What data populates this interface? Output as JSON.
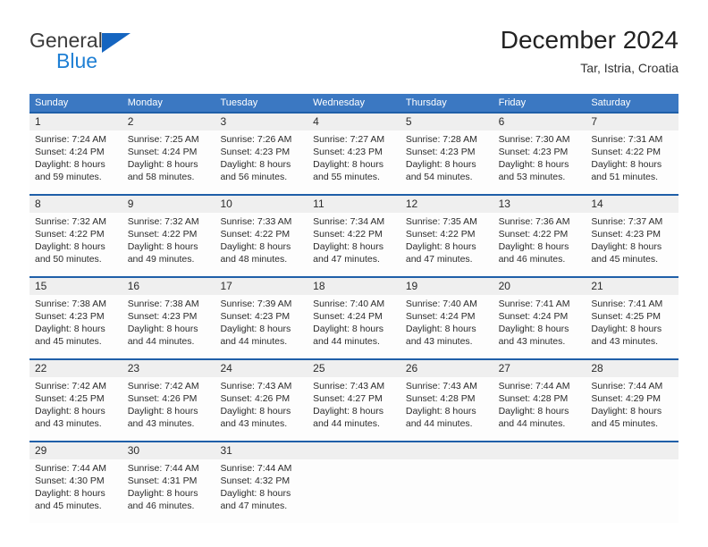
{
  "brand": {
    "name_part1": "General",
    "name_part2": "Blue",
    "icon": "flag-triangle-icon"
  },
  "header": {
    "title": "December 2024",
    "subtitle": "Tar, Istria, Croatia"
  },
  "colors": {
    "header_blue": "#3b78c2",
    "row_divider_blue": "#1f5fa8",
    "daynum_band": "#efefef",
    "brand_blue": "#1e7fd4"
  },
  "weekdays": [
    "Sunday",
    "Monday",
    "Tuesday",
    "Wednesday",
    "Thursday",
    "Friday",
    "Saturday"
  ],
  "weeks": [
    {
      "days": [
        {
          "num": "1",
          "sunrise": "Sunrise: 7:24 AM",
          "sunset": "Sunset: 4:24 PM",
          "daylight1": "Daylight: 8 hours",
          "daylight2": "and 59 minutes."
        },
        {
          "num": "2",
          "sunrise": "Sunrise: 7:25 AM",
          "sunset": "Sunset: 4:24 PM",
          "daylight1": "Daylight: 8 hours",
          "daylight2": "and 58 minutes."
        },
        {
          "num": "3",
          "sunrise": "Sunrise: 7:26 AM",
          "sunset": "Sunset: 4:23 PM",
          "daylight1": "Daylight: 8 hours",
          "daylight2": "and 56 minutes."
        },
        {
          "num": "4",
          "sunrise": "Sunrise: 7:27 AM",
          "sunset": "Sunset: 4:23 PM",
          "daylight1": "Daylight: 8 hours",
          "daylight2": "and 55 minutes."
        },
        {
          "num": "5",
          "sunrise": "Sunrise: 7:28 AM",
          "sunset": "Sunset: 4:23 PM",
          "daylight1": "Daylight: 8 hours",
          "daylight2": "and 54 minutes."
        },
        {
          "num": "6",
          "sunrise": "Sunrise: 7:30 AM",
          "sunset": "Sunset: 4:23 PM",
          "daylight1": "Daylight: 8 hours",
          "daylight2": "and 53 minutes."
        },
        {
          "num": "7",
          "sunrise": "Sunrise: 7:31 AM",
          "sunset": "Sunset: 4:22 PM",
          "daylight1": "Daylight: 8 hours",
          "daylight2": "and 51 minutes."
        }
      ]
    },
    {
      "days": [
        {
          "num": "8",
          "sunrise": "Sunrise: 7:32 AM",
          "sunset": "Sunset: 4:22 PM",
          "daylight1": "Daylight: 8 hours",
          "daylight2": "and 50 minutes."
        },
        {
          "num": "9",
          "sunrise": "Sunrise: 7:32 AM",
          "sunset": "Sunset: 4:22 PM",
          "daylight1": "Daylight: 8 hours",
          "daylight2": "and 49 minutes."
        },
        {
          "num": "10",
          "sunrise": "Sunrise: 7:33 AM",
          "sunset": "Sunset: 4:22 PM",
          "daylight1": "Daylight: 8 hours",
          "daylight2": "and 48 minutes."
        },
        {
          "num": "11",
          "sunrise": "Sunrise: 7:34 AM",
          "sunset": "Sunset: 4:22 PM",
          "daylight1": "Daylight: 8 hours",
          "daylight2": "and 47 minutes."
        },
        {
          "num": "12",
          "sunrise": "Sunrise: 7:35 AM",
          "sunset": "Sunset: 4:22 PM",
          "daylight1": "Daylight: 8 hours",
          "daylight2": "and 47 minutes."
        },
        {
          "num": "13",
          "sunrise": "Sunrise: 7:36 AM",
          "sunset": "Sunset: 4:22 PM",
          "daylight1": "Daylight: 8 hours",
          "daylight2": "and 46 minutes."
        },
        {
          "num": "14",
          "sunrise": "Sunrise: 7:37 AM",
          "sunset": "Sunset: 4:23 PM",
          "daylight1": "Daylight: 8 hours",
          "daylight2": "and 45 minutes."
        }
      ]
    },
    {
      "days": [
        {
          "num": "15",
          "sunrise": "Sunrise: 7:38 AM",
          "sunset": "Sunset: 4:23 PM",
          "daylight1": "Daylight: 8 hours",
          "daylight2": "and 45 minutes."
        },
        {
          "num": "16",
          "sunrise": "Sunrise: 7:38 AM",
          "sunset": "Sunset: 4:23 PM",
          "daylight1": "Daylight: 8 hours",
          "daylight2": "and 44 minutes."
        },
        {
          "num": "17",
          "sunrise": "Sunrise: 7:39 AM",
          "sunset": "Sunset: 4:23 PM",
          "daylight1": "Daylight: 8 hours",
          "daylight2": "and 44 minutes."
        },
        {
          "num": "18",
          "sunrise": "Sunrise: 7:40 AM",
          "sunset": "Sunset: 4:24 PM",
          "daylight1": "Daylight: 8 hours",
          "daylight2": "and 44 minutes."
        },
        {
          "num": "19",
          "sunrise": "Sunrise: 7:40 AM",
          "sunset": "Sunset: 4:24 PM",
          "daylight1": "Daylight: 8 hours",
          "daylight2": "and 43 minutes."
        },
        {
          "num": "20",
          "sunrise": "Sunrise: 7:41 AM",
          "sunset": "Sunset: 4:24 PM",
          "daylight1": "Daylight: 8 hours",
          "daylight2": "and 43 minutes."
        },
        {
          "num": "21",
          "sunrise": "Sunrise: 7:41 AM",
          "sunset": "Sunset: 4:25 PM",
          "daylight1": "Daylight: 8 hours",
          "daylight2": "and 43 minutes."
        }
      ]
    },
    {
      "days": [
        {
          "num": "22",
          "sunrise": "Sunrise: 7:42 AM",
          "sunset": "Sunset: 4:25 PM",
          "daylight1": "Daylight: 8 hours",
          "daylight2": "and 43 minutes."
        },
        {
          "num": "23",
          "sunrise": "Sunrise: 7:42 AM",
          "sunset": "Sunset: 4:26 PM",
          "daylight1": "Daylight: 8 hours",
          "daylight2": "and 43 minutes."
        },
        {
          "num": "24",
          "sunrise": "Sunrise: 7:43 AM",
          "sunset": "Sunset: 4:26 PM",
          "daylight1": "Daylight: 8 hours",
          "daylight2": "and 43 minutes."
        },
        {
          "num": "25",
          "sunrise": "Sunrise: 7:43 AM",
          "sunset": "Sunset: 4:27 PM",
          "daylight1": "Daylight: 8 hours",
          "daylight2": "and 44 minutes."
        },
        {
          "num": "26",
          "sunrise": "Sunrise: 7:43 AM",
          "sunset": "Sunset: 4:28 PM",
          "daylight1": "Daylight: 8 hours",
          "daylight2": "and 44 minutes."
        },
        {
          "num": "27",
          "sunrise": "Sunrise: 7:44 AM",
          "sunset": "Sunset: 4:28 PM",
          "daylight1": "Daylight: 8 hours",
          "daylight2": "and 44 minutes."
        },
        {
          "num": "28",
          "sunrise": "Sunrise: 7:44 AM",
          "sunset": "Sunset: 4:29 PM",
          "daylight1": "Daylight: 8 hours",
          "daylight2": "and 45 minutes."
        }
      ]
    },
    {
      "days": [
        {
          "num": "29",
          "sunrise": "Sunrise: 7:44 AM",
          "sunset": "Sunset: 4:30 PM",
          "daylight1": "Daylight: 8 hours",
          "daylight2": "and 45 minutes."
        },
        {
          "num": "30",
          "sunrise": "Sunrise: 7:44 AM",
          "sunset": "Sunset: 4:31 PM",
          "daylight1": "Daylight: 8 hours",
          "daylight2": "and 46 minutes."
        },
        {
          "num": "31",
          "sunrise": "Sunrise: 7:44 AM",
          "sunset": "Sunset: 4:32 PM",
          "daylight1": "Daylight: 8 hours",
          "daylight2": "and 47 minutes."
        },
        {
          "num": "",
          "sunrise": "",
          "sunset": "",
          "daylight1": "",
          "daylight2": ""
        },
        {
          "num": "",
          "sunrise": "",
          "sunset": "",
          "daylight1": "",
          "daylight2": ""
        },
        {
          "num": "",
          "sunrise": "",
          "sunset": "",
          "daylight1": "",
          "daylight2": ""
        },
        {
          "num": "",
          "sunrise": "",
          "sunset": "",
          "daylight1": "",
          "daylight2": ""
        }
      ]
    }
  ]
}
